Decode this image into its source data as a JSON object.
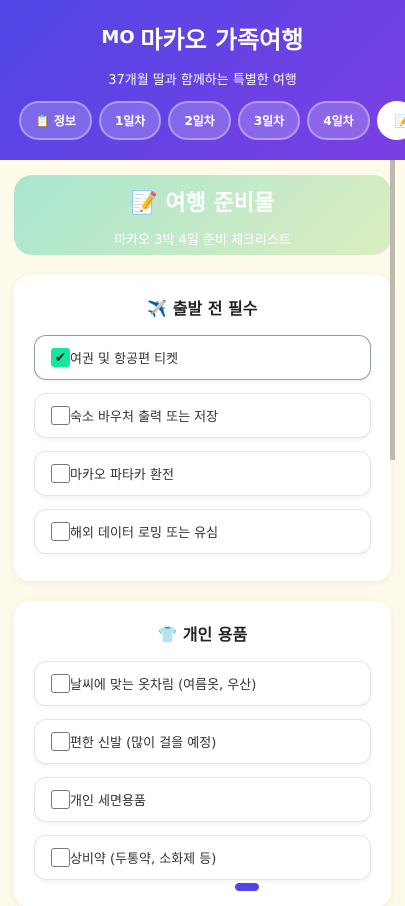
{
  "header": {
    "logo": "MO",
    "title": "마카오 가족여행",
    "subtitle": "37개월 딸과 함께하는 특별한 여행"
  },
  "tabs": [
    {
      "icon": "📋",
      "label": "정보"
    },
    {
      "label": "1일차"
    },
    {
      "label": "2일차"
    },
    {
      "label": "3일차"
    },
    {
      "label": "4일차"
    },
    {
      "icon": "📝",
      "label": "",
      "active": true
    }
  ],
  "banner": {
    "icon": "📝",
    "title": "여행 준비물",
    "subtitle": "마카오 3박 4일 준비 체크리스트"
  },
  "sections": [
    {
      "icon": "✈️",
      "title": "출발 전 필수",
      "items": [
        {
          "label": "여권 및 항공편 티켓",
          "checked": true
        },
        {
          "label": "숙소 바우처 출력 또는 저장",
          "checked": false
        },
        {
          "label": "마카오 파타카 환전",
          "checked": false
        },
        {
          "label": "해외 데이터 로밍 또는 유심",
          "checked": false
        }
      ]
    },
    {
      "icon": "👕",
      "title": "개인 용품",
      "items": [
        {
          "label": "날씨에 맞는 옷차림 (여름옷, 우산)",
          "checked": false
        },
        {
          "label": "편한 신발 (많이 걸을 예정)",
          "checked": false
        },
        {
          "label": "개인 세면용품",
          "checked": false
        },
        {
          "label": "상비약 (두통약, 소화제 등)",
          "checked": false
        }
      ]
    }
  ],
  "pagination": {
    "count": 6,
    "active": 5
  },
  "colors": {
    "accent": "#5046e5",
    "checked": "#14e8a0"
  }
}
